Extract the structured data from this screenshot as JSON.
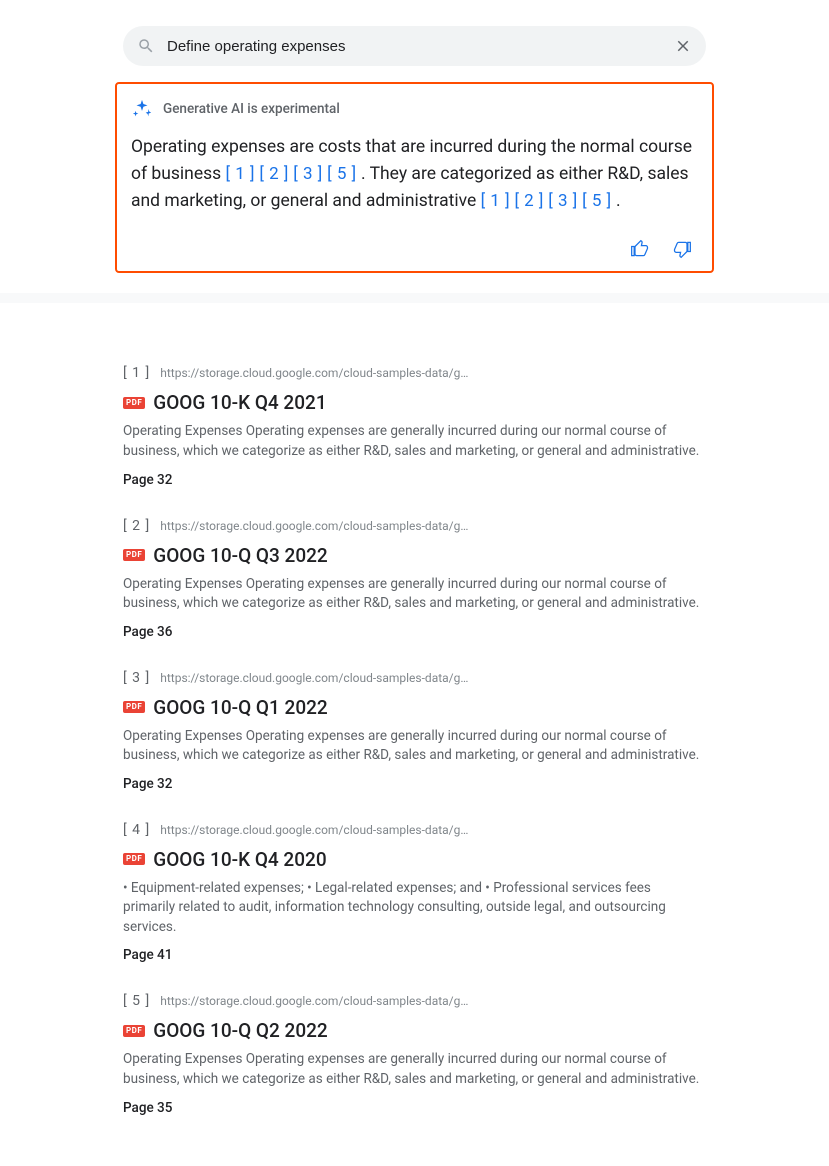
{
  "search": {
    "value": "Define operating expenses"
  },
  "ai": {
    "label": "Generative AI is experimental",
    "sentence1_a": "Operating expenses are costs that are incurred during the normal course of business ",
    "cites1": [
      "[ 1 ]",
      "[ 2 ]",
      "[ 3 ]",
      "[ 5 ]"
    ],
    "sentence1_b": " . They are categorized as either R&D, sales and marketing, or general and administrative ",
    "cites2": [
      "[ 1 ]",
      "[ 2 ]",
      "[ 3 ]",
      "[ 5 ]"
    ],
    "sentence1_c": " ."
  },
  "pdf_label": "PDF",
  "results": [
    {
      "num": "[ 1 ]",
      "url": "https://storage.cloud.google.com/cloud-samples-data/gen-a...",
      "title": "GOOG 10-K Q4 2021",
      "snippet": "Operating Expenses Operating expenses are generally incurred during our normal course of business, which we categorize as either R&D, sales and marketing, or general and administrative.",
      "page": "Page 32"
    },
    {
      "num": "[ 2 ]",
      "url": "https://storage.cloud.google.com/cloud-samples-data/gen-a...",
      "title": "GOOG 10-Q Q3 2022",
      "snippet": "Operating Expenses Operating expenses are generally incurred during our normal course of business, which we categorize as either R&D, sales and marketing, or general and administrative.",
      "page": "Page 36"
    },
    {
      "num": "[ 3 ]",
      "url": "https://storage.cloud.google.com/cloud-samples-data/gen-a...",
      "title": "GOOG 10-Q Q1 2022",
      "snippet": "Operating Expenses Operating expenses are generally incurred during our normal course of business, which we categorize as either R&D, sales and marketing, or general and administrative.",
      "page": "Page 32"
    },
    {
      "num": "[ 4 ]",
      "url": "https://storage.cloud.google.com/cloud-samples-data/gen-a...",
      "title": "GOOG 10-K Q4 2020",
      "snippet": "• Equipment-related expenses; • Legal-related expenses; and • Professional services fees primarily related to audit, information technology consulting, outside legal, and outsourcing services.",
      "page": "Page 41"
    },
    {
      "num": "[ 5 ]",
      "url": "https://storage.cloud.google.com/cloud-samples-data/gen-a...",
      "title": "GOOG 10-Q Q2 2022",
      "snippet": "Operating Expenses Operating expenses are generally incurred during our normal course of business, which we categorize as either R&D, sales and marketing, or general and administrative.",
      "page": "Page 35"
    }
  ]
}
